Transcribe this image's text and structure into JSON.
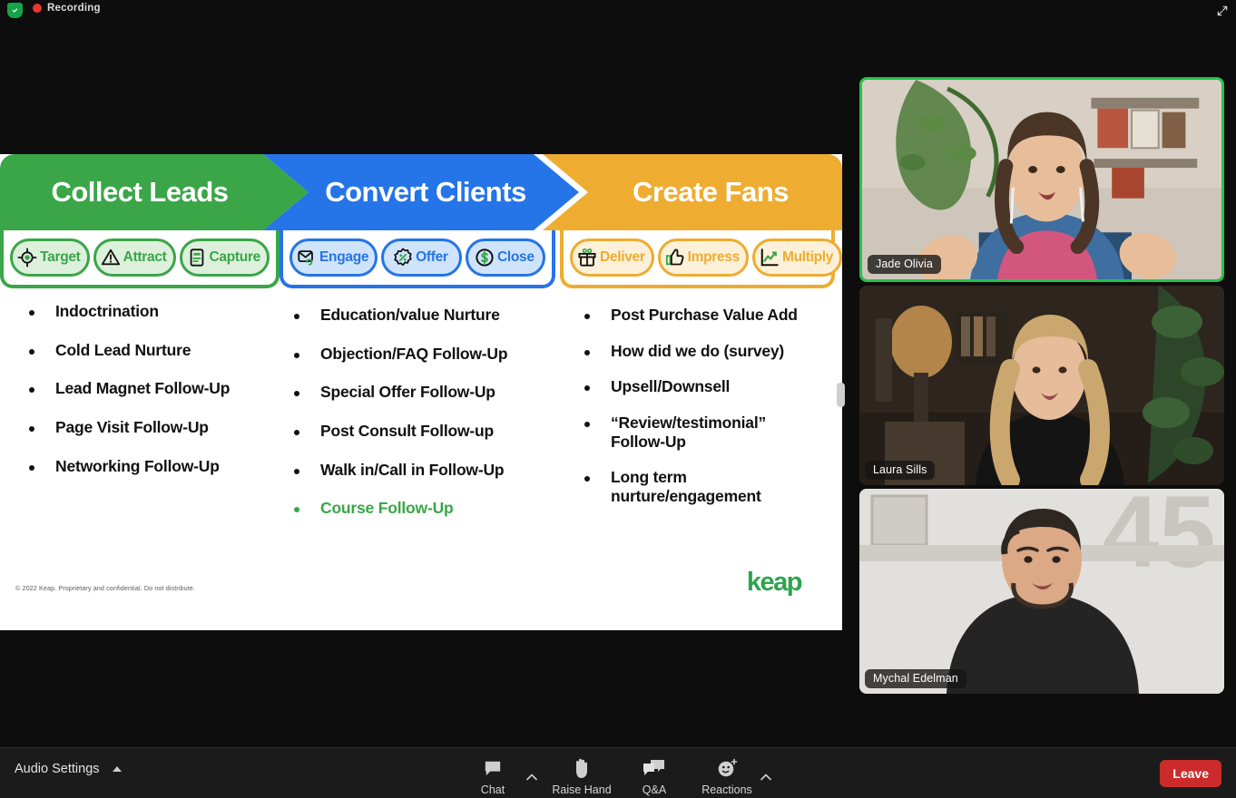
{
  "topbar": {
    "shield_icon": "shield-check-icon",
    "recording_label": "Recording",
    "expand_icon": "expand-diagonal-icon"
  },
  "slide": {
    "sections": [
      {
        "title": "Collect Leads",
        "color": "#3aa648",
        "badges": [
          {
            "label": "Target",
            "icon": "target-icon"
          },
          {
            "label": "Attract",
            "icon": "warning-triangle-icon"
          },
          {
            "label": "Capture",
            "icon": "form-document-icon"
          }
        ],
        "bullets": [
          {
            "text": "Indoctrination",
            "highlight": false
          },
          {
            "text": "Cold Lead Nurture",
            "highlight": false
          },
          {
            "text": "Lead Magnet Follow-Up",
            "highlight": false
          },
          {
            "text": "Page Visit Follow-Up",
            "highlight": false
          },
          {
            "text": "Networking Follow-Up",
            "highlight": false
          }
        ]
      },
      {
        "title": "Convert Clients",
        "color": "#2574e8",
        "badges": [
          {
            "label": "Engage",
            "icon": "envelope-icon"
          },
          {
            "label": "Offer",
            "icon": "percent-badge-icon"
          },
          {
            "label": "Close",
            "icon": "dollar-circle-icon"
          }
        ],
        "bullets": [
          {
            "text": "Education/value Nurture",
            "highlight": false
          },
          {
            "text": "Objection/FAQ Follow-Up",
            "highlight": false
          },
          {
            "text": "Special Offer Follow-Up",
            "highlight": false
          },
          {
            "text": "Post Consult Follow-up",
            "highlight": false
          },
          {
            "text": "Walk in/Call in Follow-Up",
            "highlight": false
          },
          {
            "text": "Course Follow-Up",
            "highlight": true
          }
        ]
      },
      {
        "title": "Create Fans",
        "color": "#eeac31",
        "badges": [
          {
            "label": "Deliver",
            "icon": "gift-icon"
          },
          {
            "label": "Impress",
            "icon": "thumbs-up-icon"
          },
          {
            "label": "Multiply",
            "icon": "line-chart-icon"
          }
        ],
        "bullets": [
          {
            "text": "Post Purchase Value Add",
            "highlight": false
          },
          {
            "text": "How did we do (survey)",
            "highlight": false
          },
          {
            "text": "Upsell/Downsell",
            "highlight": false
          },
          {
            "text": "“Review/testimonial” Follow-Up",
            "highlight": false
          },
          {
            "text": "Long term nurture/engagement",
            "highlight": false
          }
        ]
      }
    ],
    "footnote": "© 2022 Keap. Proprietary and confidential. Do not distribute.",
    "logo_text": "keap",
    "logo_color": "#2ea44f"
  },
  "participants": [
    {
      "name": "Jade Olivia",
      "speaking": true
    },
    {
      "name": "Laura Sills",
      "speaking": false
    },
    {
      "name": "Mychal Edelman",
      "speaking": false
    }
  ],
  "toolbar": {
    "audio_settings_label": "Audio Settings",
    "audio_settings_icon": "chevron-up-icon",
    "controls": [
      {
        "label": "Chat",
        "icon": "chat-bubble-icon",
        "has_arrow": true
      },
      {
        "label": "Raise Hand",
        "icon": "raised-hand-icon",
        "has_arrow": false
      },
      {
        "label": "Q&A",
        "icon": "qa-bubbles-icon",
        "has_arrow": false
      },
      {
        "label": "Reactions",
        "icon": "smiley-sparkle-icon",
        "has_arrow": true
      }
    ],
    "leave_label": "Leave",
    "leave_color": "#cc2b2b"
  }
}
